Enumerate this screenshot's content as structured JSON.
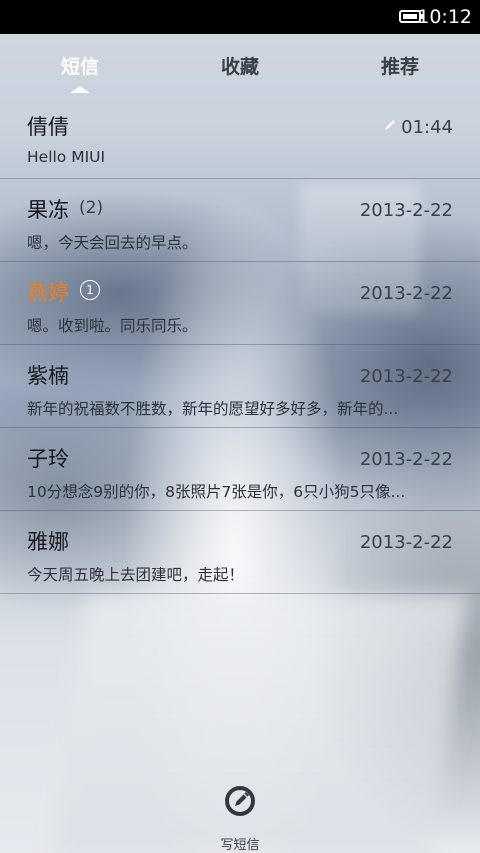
{
  "status_bar": {
    "time": "10:12",
    "battery_icon": "battery-full-icon"
  },
  "tabs": [
    {
      "label": "短信",
      "active": true
    },
    {
      "label": "收藏",
      "active": false
    },
    {
      "label": "推荐",
      "active": false
    }
  ],
  "conversations": [
    {
      "name": "倩倩",
      "count": "",
      "unread_badge": "",
      "date": "01:44",
      "draft_icon": "pencil-icon",
      "preview": "Hello MIUI"
    },
    {
      "name": "果冻",
      "count": "(2)",
      "unread_badge": "",
      "date": "2013-2-22",
      "preview": "嗯，今天会回去的早点。"
    },
    {
      "name": "燕婷",
      "count": "",
      "unread_badge": "1",
      "date": "2013-2-22",
      "preview": "嗯。收到啦。同乐同乐。"
    },
    {
      "name": "紫楠",
      "count": "",
      "unread_badge": "",
      "date": "2013-2-22",
      "preview": "新年的祝福数不胜数，新年的愿望好多好多，新年的..."
    },
    {
      "name": "子玲",
      "count": "",
      "unread_badge": "",
      "date": "2013-2-22",
      "preview": "10分想念9别的你，8张照片7张是你，6只小狗5只像..."
    },
    {
      "name": "雅娜",
      "count": "",
      "unread_badge": "",
      "date": "2013-2-22",
      "preview": "今天周五晚上去团建吧，走起！"
    }
  ],
  "compose": {
    "label": "写短信",
    "icon": "compose-icon"
  },
  "colors": {
    "unread_name": "#ef7d1a",
    "active_tab": "#ffffff"
  }
}
